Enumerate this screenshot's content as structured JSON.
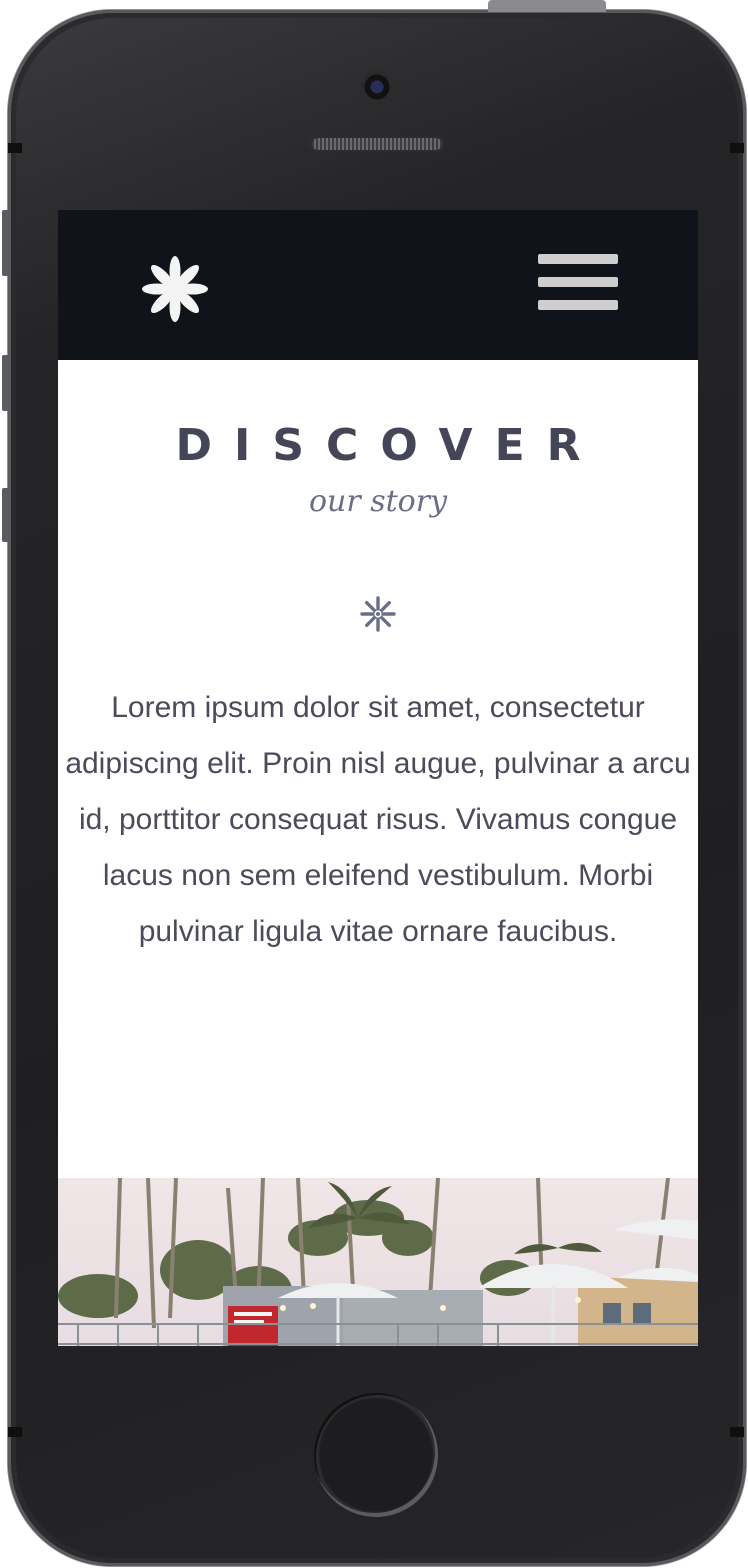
{
  "header": {
    "logo_icon": "asterisk-flower-icon",
    "menu_icon": "hamburger-menu-icon"
  },
  "main": {
    "title": "DISCOVER",
    "subtitle": "our story",
    "divider_icon": "asterisk-flower-icon",
    "paragraph": "Lorem ipsum dolor sit amet, consectetur adipiscing elit. Proin nisl augue, pulvinar a arcu id, porttitor consequat risus. Vivamus congue lacus non sem eleifend vestibulum. Morbi pulvinar ligula vitae ornare faucibus."
  },
  "colors": {
    "header_bg": "#10131a",
    "title": "#444557",
    "subtitle": "#6a6e86",
    "body_text": "#4a4b5b",
    "device_body": "#1f1f21"
  }
}
